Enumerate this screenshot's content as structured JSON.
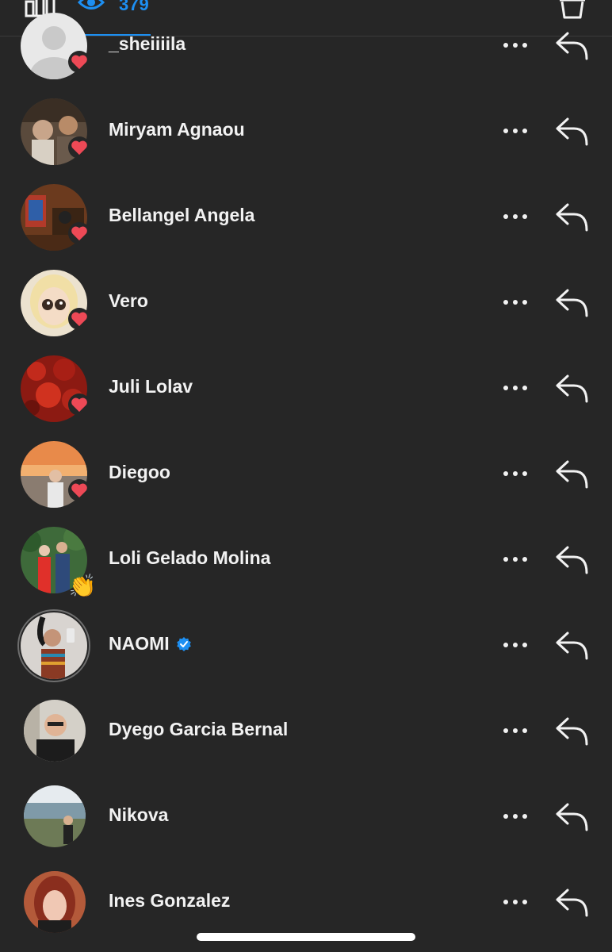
{
  "header": {
    "viewers_count": "379",
    "colors": {
      "accent": "#1d8ff2",
      "background": "#262626",
      "heart": "#ed4956"
    },
    "icons": [
      "chart-icon",
      "eye-icon",
      "trash-icon"
    ]
  },
  "viewers": [
    {
      "name": "_sheiiiila",
      "reaction": "heart",
      "verified": false
    },
    {
      "name": "Miryam Agnaou",
      "reaction": "heart",
      "verified": false
    },
    {
      "name": "Bellangel Angela",
      "reaction": "heart",
      "verified": false
    },
    {
      "name": "Vero",
      "reaction": "heart",
      "verified": false
    },
    {
      "name": "Juli Lolav",
      "reaction": "heart",
      "verified": false
    },
    {
      "name": "Diegoo",
      "reaction": "heart",
      "verified": false
    },
    {
      "name": "Loli Gelado Molina",
      "reaction": "👏",
      "verified": false
    },
    {
      "name": "NAOMI",
      "reaction": "",
      "verified": true
    },
    {
      "name": "Dyego Garcia Bernal",
      "reaction": "",
      "verified": false
    },
    {
      "name": "Nikova",
      "reaction": "",
      "verified": false
    },
    {
      "name": "Ines Gonzalez",
      "reaction": "",
      "verified": false
    }
  ]
}
